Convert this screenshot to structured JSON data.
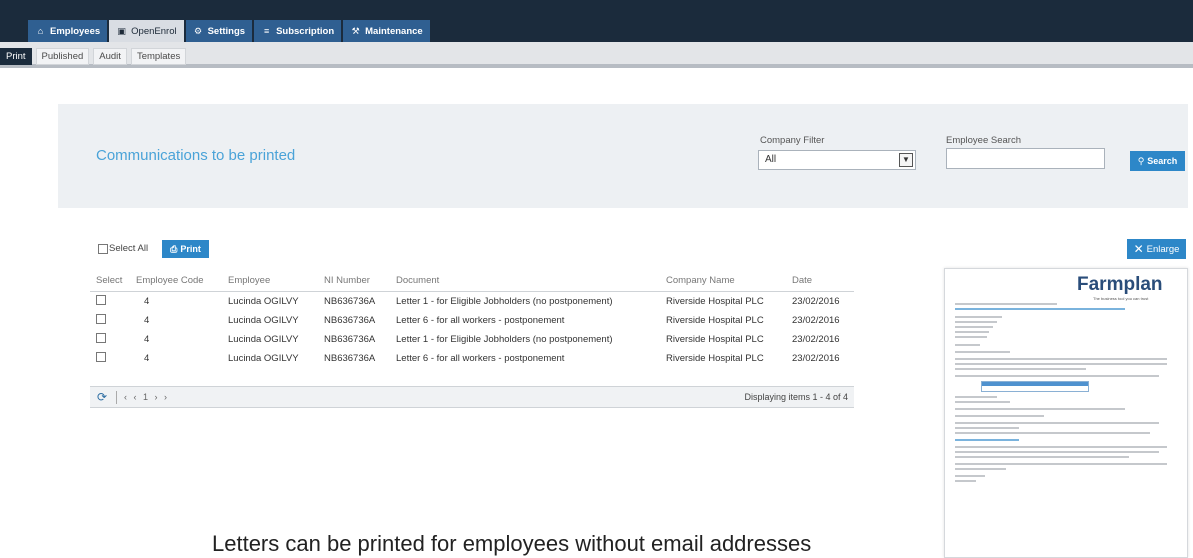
{
  "nav": {
    "main_tabs": [
      {
        "label": "Employees",
        "icon": "home-icon",
        "glyph": "⌂"
      },
      {
        "label": "OpenEnrol",
        "icon": "building-icon",
        "glyph": "▣"
      },
      {
        "label": "Settings",
        "icon": "gear-icon",
        "glyph": "⚙"
      },
      {
        "label": "Subscription",
        "icon": "list-icon",
        "glyph": "≡"
      },
      {
        "label": "Maintenance",
        "icon": "wrench-icon",
        "glyph": "⚒"
      }
    ],
    "sub_tabs": [
      "Print",
      "Published",
      "Audit",
      "Templates"
    ]
  },
  "filters": {
    "title": "Communications to be printed",
    "company_label": "Company Filter",
    "company_value": "All",
    "employee_label": "Employee Search",
    "employee_value": "",
    "search_label": "Search"
  },
  "toolbar": {
    "select_all_label": "Select All",
    "print_label": "Print",
    "enlarge_label": "Enlarge"
  },
  "table": {
    "columns": [
      "Select",
      "Employee Code",
      "Employee",
      "NI Number",
      "Document",
      "Company Name",
      "Date"
    ],
    "rows": [
      {
        "code": "4",
        "employee": "Lucinda OGILVY",
        "ni": "NB636736A",
        "document": "Letter 1 - for Eligible Jobholders (no postponement)",
        "company": "Riverside Hospital PLC",
        "date": "23/02/2016"
      },
      {
        "code": "4",
        "employee": "Lucinda OGILVY",
        "ni": "NB636736A",
        "document": "Letter 6 - for all workers - postponement",
        "company": "Riverside Hospital PLC",
        "date": "23/02/2016"
      },
      {
        "code": "4",
        "employee": "Lucinda OGILVY",
        "ni": "NB636736A",
        "document": "Letter 1 - for Eligible Jobholders (no postponement)",
        "company": "Riverside Hospital PLC",
        "date": "23/02/2016"
      },
      {
        "code": "4",
        "employee": "Lucinda OGILVY",
        "ni": "NB636736A",
        "document": "Letter 6 - for all workers - postponement",
        "company": "Riverside Hospital PLC",
        "date": "23/02/2016"
      }
    ],
    "pager": "‹ ‹ 1 › ›",
    "display_info": "Displaying items 1 - 4 of 4"
  },
  "preview": {
    "brand": "Farmplan",
    "tagline": "The business tool you can trust"
  },
  "caption": "Letters can be printed for employees without email addresses",
  "colors": {
    "topbar": "#1b2b3c",
    "tab": "#2f5f91",
    "accent": "#2d87c8",
    "title": "#4aa3d8"
  }
}
